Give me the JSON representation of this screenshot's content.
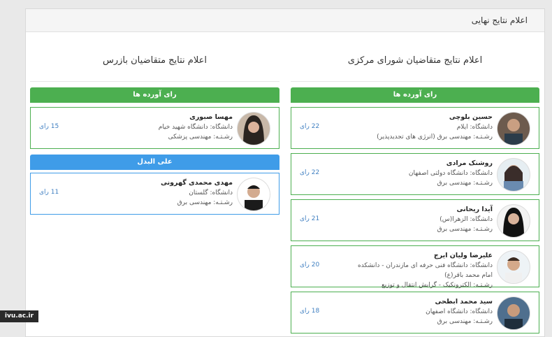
{
  "header": {
    "title": "اعلام نتایج نهایی"
  },
  "central": {
    "title": "اعلام نتایج متقاضیان شورای مرکزی",
    "group_label": "رای آورده ها",
    "candidates": [
      {
        "name": "حسین بلوچی",
        "university": "دانشگاه: ایلام",
        "university_extra": "",
        "major": "رشـتـه: مهندسی برق (انرژی های تجدیدپذیر)",
        "votes": "22 رای"
      },
      {
        "name": "روشنک مرادی",
        "university": "دانشگاه: دانشگاه دولتی اصفهان",
        "university_extra": "",
        "major": "رشـتـه: مهندسی برق",
        "votes": "22 رای"
      },
      {
        "name": "آیدا ریحانی",
        "university": "دانشگاه: الزهرا(س)",
        "university_extra": "",
        "major": "رشـتـه: مهندسی برق",
        "votes": "21 رای"
      },
      {
        "name": "علیرضا ولیان ایرج",
        "university": "دانشگاه: دانشگاه فنی حرفه ای مازندران - دانشکده",
        "university_extra": "امام محمد باقر(ع)",
        "major": "رشـتـه: الکترونکیک - گرایش انتقال و توزیع",
        "votes": "20 رای"
      },
      {
        "name": "سید محمد ابطحی",
        "university": "دانشگاه: دانشگاه اصفهان",
        "university_extra": "",
        "major": "رشـتـه: مهندسی برق",
        "votes": "18 رای"
      }
    ]
  },
  "inspector": {
    "title": "اعلام نتایج متقاضیان بازرس",
    "group_label": "رای آورده ها",
    "candidates": [
      {
        "name": "مهسا صبوری",
        "university": "دانشگاه: دانشگاه شهید خیام",
        "major": "رشـتـه: مهندسی پزشکی",
        "votes": "15 رای"
      }
    ],
    "alternate_label": "علی البدل",
    "alternates": [
      {
        "name": "مهدی محمدی گهرونی",
        "university": "دانشگاه: گلستان",
        "major": "رشـتـه: مهندسی برق",
        "votes": "11 رای"
      }
    ]
  },
  "watermark": "ivu.ac.ir"
}
